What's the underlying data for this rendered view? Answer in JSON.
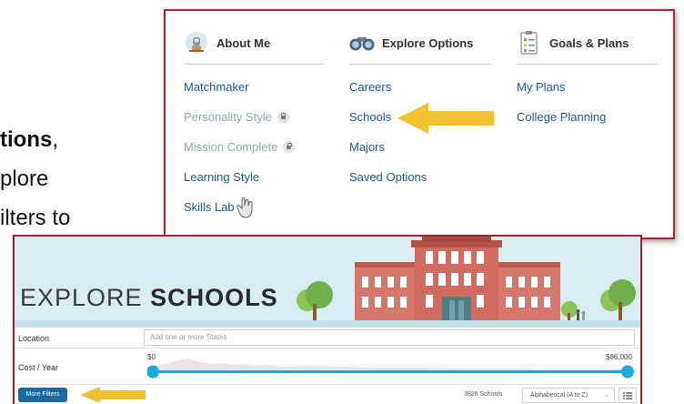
{
  "background_text": {
    "line1_bold": "tions",
    "line1_rest": ",",
    "line2": "plore",
    "line3": "ilters to"
  },
  "menu": {
    "columns": [
      {
        "heading": "About Me",
        "icon": "astronaut-icon",
        "items": [
          {
            "label": "Matchmaker",
            "locked": false
          },
          {
            "label": "Personality Style",
            "locked": true
          },
          {
            "label": "Mission Complete",
            "locked": true
          },
          {
            "label": "Learning Style",
            "locked": false
          },
          {
            "label": "Skills Lab",
            "locked": false
          }
        ]
      },
      {
        "heading": "Explore Options",
        "icon": "binoculars-icon",
        "items": [
          {
            "label": "Careers"
          },
          {
            "label": "Schools"
          },
          {
            "label": "Majors"
          },
          {
            "label": "Saved Options"
          }
        ]
      },
      {
        "heading": "Goals & Plans",
        "icon": "checklist-icon",
        "items": [
          {
            "label": "My Plans"
          },
          {
            "label": "College Planning"
          }
        ]
      }
    ]
  },
  "explore": {
    "title_light": "EXPLORE",
    "title_bold": "SCHOOLS",
    "location_label": "Location",
    "location_placeholder": "Add one or more States",
    "cost_label": "Cost / Year",
    "cost_min": "$0",
    "cost_max": "$86,000",
    "more_filters": "More Filters",
    "school_count": "3826 Schools",
    "sort_value": "Alphabetical (A to Z)"
  },
  "colors": {
    "accent_border": "#b8212b",
    "link": "#1a5a8e",
    "arrow": "#f2c12e",
    "slider": "#1fa8de"
  }
}
